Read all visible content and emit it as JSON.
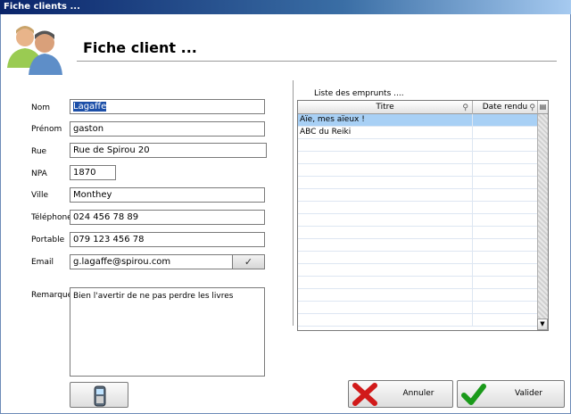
{
  "window": {
    "title": "Fiche clients ..."
  },
  "header": {
    "title": "Fiche client ...",
    "avatar_icon": "users-icon"
  },
  "form": {
    "nom": {
      "label": "Nom",
      "value": "Lagaffe"
    },
    "prenom": {
      "label": "Prénom",
      "value": "gaston"
    },
    "rue": {
      "label": "Rue",
      "value": "Rue de Spirou 20"
    },
    "npa": {
      "label": "NPA",
      "value": "1870"
    },
    "ville": {
      "label": "Ville",
      "value": "Monthey"
    },
    "telephone": {
      "label": "Téléphone",
      "value": "024 456 78 89"
    },
    "portable": {
      "label": "Portable",
      "value": "079 123 456 78"
    },
    "email": {
      "label": "Email",
      "value": "g.lagaffe@spirou.com",
      "button_icon": "checkmark-icon"
    },
    "remarque": {
      "label": "Remarque",
      "value": "Bien l'avertir de ne pas perdre les livres"
    }
  },
  "emprunts": {
    "label": "Liste des emprunts ....",
    "columns": [
      "Titre",
      "Date rendu"
    ],
    "rows": [
      {
        "titre": "Aïe, mes aïeux !",
        "date": ""
      },
      {
        "titre": "ABC du Reiki",
        "date": ""
      }
    ],
    "empty_rows": 15,
    "selected_index": 0
  },
  "buttons": {
    "phone_icon": "mobile-phone-icon",
    "annuler": {
      "label": "Annuler",
      "icon": "cross-icon",
      "color": "#d11a1a"
    },
    "valider": {
      "label": "Valider",
      "icon": "checkmark-icon",
      "color": "#1a9a1a"
    }
  }
}
